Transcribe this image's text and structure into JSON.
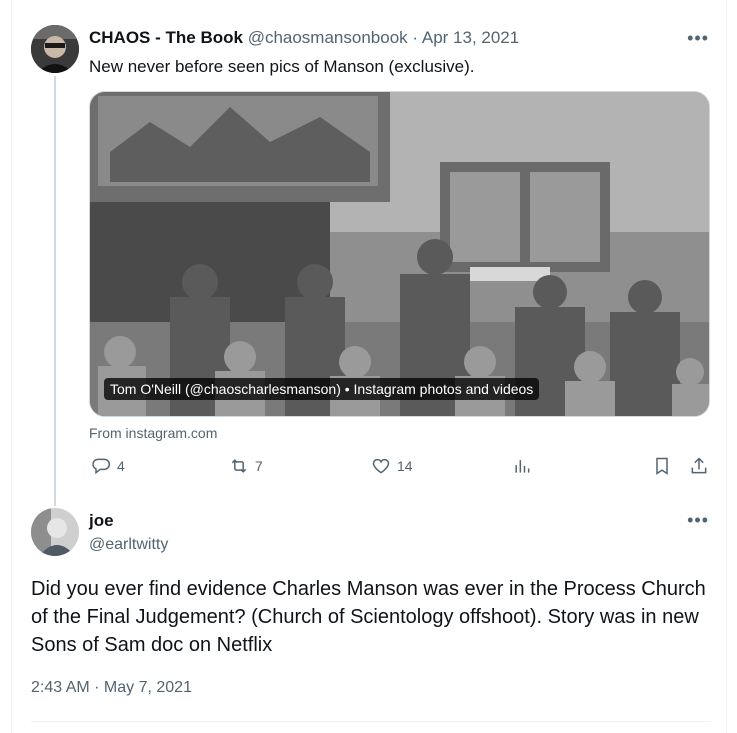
{
  "parent": {
    "name": "CHAOS - The Book",
    "handle": "@chaosmansonbook",
    "separator": "·",
    "date": "Apr 13, 2021",
    "text": "New never before seen pics of Manson (exclusive).",
    "media_caption": "Tom O'Neill (@chaoscharlesmanson) • Instagram photos and videos",
    "source": "From instagram.com",
    "more_label": "•••",
    "actions": {
      "replies": "4",
      "retweets": "7",
      "likes": "14"
    },
    "icons": [
      "reply-icon",
      "retweet-icon",
      "like-icon",
      "views-icon",
      "bookmark-icon",
      "share-icon"
    ]
  },
  "reply": {
    "name": "joe",
    "handle": "@earltwitty",
    "more_label": "•••",
    "text": "Did you ever find evidence Charles Manson was ever in the Process Church of the Final Judgement? (Church of Scientology offshoot). Story was in new Sons of Sam doc on Netflix",
    "timestamp": "2:43 AM · May 7, 2021"
  },
  "colors": {
    "text": "#0f1419",
    "muted": "#536471",
    "border": "#cfd9de"
  }
}
